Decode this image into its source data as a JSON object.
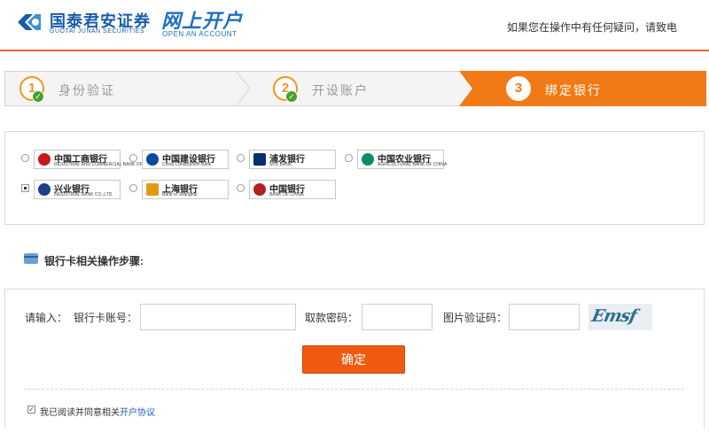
{
  "header": {
    "company_cn": "国泰君安证券",
    "company_en": "GUOTAI JUNAN SECURITIES",
    "open_cn": "网上开户",
    "open_en": "OPEN AN ACCOUNT",
    "help_text": "如果您在操作中有任何疑问，请致电",
    "brand_color": "#1a5ca8",
    "accent_color": "#e8662c"
  },
  "steps": [
    {
      "num": "1",
      "label": "身份验证",
      "status": "done"
    },
    {
      "num": "2",
      "label": "开设账户",
      "status": "done"
    },
    {
      "num": "3",
      "label": "绑定银行",
      "status": "active"
    }
  ],
  "banks": [
    {
      "name": "中国工商银行",
      "en": "INDUSTRIAL AND COMMERCIAL BANK OF CHINA",
      "selected": false,
      "color": "#c8161d"
    },
    {
      "name": "中国建设银行",
      "en": "China Construction Bank",
      "selected": false,
      "color": "#0a4a9e"
    },
    {
      "name": "浦发银行",
      "en": "SPD BANK",
      "selected": false,
      "color": "#0a2f6e"
    },
    {
      "name": "中国农业银行",
      "en": "AGRICULTURAL BANK OF CHINA",
      "selected": false,
      "color": "#0b8a6e"
    },
    {
      "name": "兴业银行",
      "en": "INDUSTRIAL BANK CO.,LTD.",
      "selected": true,
      "color": "#1b3f8c"
    },
    {
      "name": "上海银行",
      "en": "Bank of Shanghai",
      "selected": false,
      "color": "#e39a12"
    },
    {
      "name": "中国银行",
      "en": "BANK OF CHINA",
      "selected": false,
      "color": "#b41f24"
    }
  ],
  "section_title": "银行卡相关操作步骤:",
  "form": {
    "prompt": "请输入：",
    "card_label": "银行卡账号：",
    "card_value": "",
    "pwd_label": "取款密码：",
    "pwd_value": "",
    "captcha_label": "图片验证码：",
    "captcha_value": "",
    "captcha_image_text": "Emsf",
    "confirm_label": "确定",
    "agree_text": "我已阅读并同意相关",
    "agree_link": "开户协议",
    "agree_checked": true
  }
}
